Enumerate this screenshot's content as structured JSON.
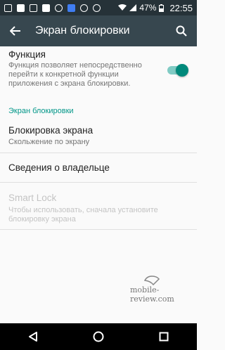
{
  "status_bar": {
    "battery": "47%",
    "time": "22:55"
  },
  "app_bar": {
    "title": "Экран блокировки"
  },
  "function_item": {
    "title": "Функция",
    "description": "Функция позволяет непосредственно перейти к конкретной функции приложения с экрана блокировки.",
    "toggle_on": true
  },
  "section_header": "Экран блокировки",
  "screen_lock": {
    "title": "Блокировка экрана",
    "subtitle": "Скольжение по экрану"
  },
  "owner_info": {
    "title": "Сведения о владельце"
  },
  "smart_lock": {
    "title": "Smart Lock",
    "subtitle": "Чтобы использовать, сначала установите блокировку экрана"
  },
  "watermark": "mobile-review.com",
  "colors": {
    "status_bar": "#263238",
    "app_bar": "#37474f",
    "accent": "#009688",
    "background": "#fafafa"
  }
}
